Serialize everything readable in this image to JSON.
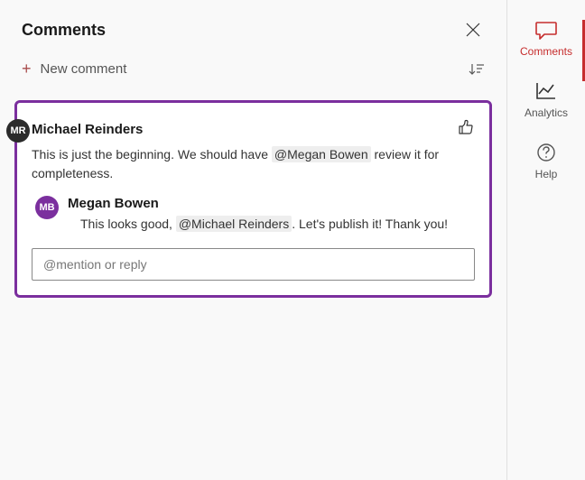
{
  "panel": {
    "title": "Comments"
  },
  "toolbar": {
    "new_comment_label": "New comment"
  },
  "thread": {
    "comment": {
      "author_initials": "MR",
      "author_name": "Michael Reinders",
      "body_before": "This is just the beginning. We should have ",
      "mention": "@Megan Bowen",
      "body_after": " review it for completeness."
    },
    "reply": {
      "author_initials": "MB",
      "author_name": "Megan Bowen",
      "body_before": "This looks good, ",
      "mention": "@Michael Reinders",
      "body_after": ". Let's publish it! Thank you!"
    },
    "reply_placeholder": "@mention or reply"
  },
  "sidebar": {
    "comments_label": "Comments",
    "analytics_label": "Analytics",
    "help_label": "Help"
  },
  "colors": {
    "accent": "#c62d2d",
    "thread_border": "#7b2f9e"
  }
}
